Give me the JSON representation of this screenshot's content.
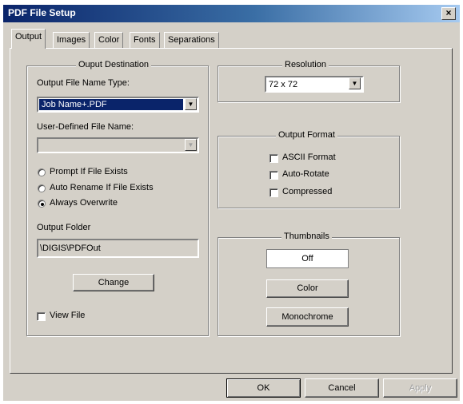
{
  "window": {
    "title": "PDF File Setup",
    "close_label": "×"
  },
  "tabs": [
    {
      "label": "Output"
    },
    {
      "label": "Images"
    },
    {
      "label": "Color"
    },
    {
      "label": "Fonts"
    },
    {
      "label": "Separations"
    }
  ],
  "output_destination": {
    "title": "Ouput Destination",
    "file_name_type_label": "Output File Name Type:",
    "file_name_type_value": "Job Name+.PDF",
    "user_defined_label": "User-Defined File Name:",
    "user_defined_value": "",
    "radios": [
      {
        "label": "Prompt If File Exists"
      },
      {
        "label": "Auto Rename If File Exists"
      },
      {
        "label": "Always Overwrite"
      }
    ],
    "output_folder_label": "Output Folder",
    "output_folder_value": "\\DIGIS\\PDFOut",
    "change_label": "Change",
    "view_file_label": "View File"
  },
  "resolution": {
    "title": "Resolution",
    "value": "72 x 72"
  },
  "output_format": {
    "title": "Output Format",
    "options": [
      {
        "label": "ASCII Format"
      },
      {
        "label": "Auto-Rotate"
      },
      {
        "label": "Compressed"
      }
    ]
  },
  "thumbnails": {
    "title": "Thumbnails",
    "value": "Off",
    "color_label": "Color",
    "monochrome_label": "Monochrome"
  },
  "footer": {
    "ok_label": "OK",
    "cancel_label": "Cancel",
    "apply_label": "Apply"
  }
}
